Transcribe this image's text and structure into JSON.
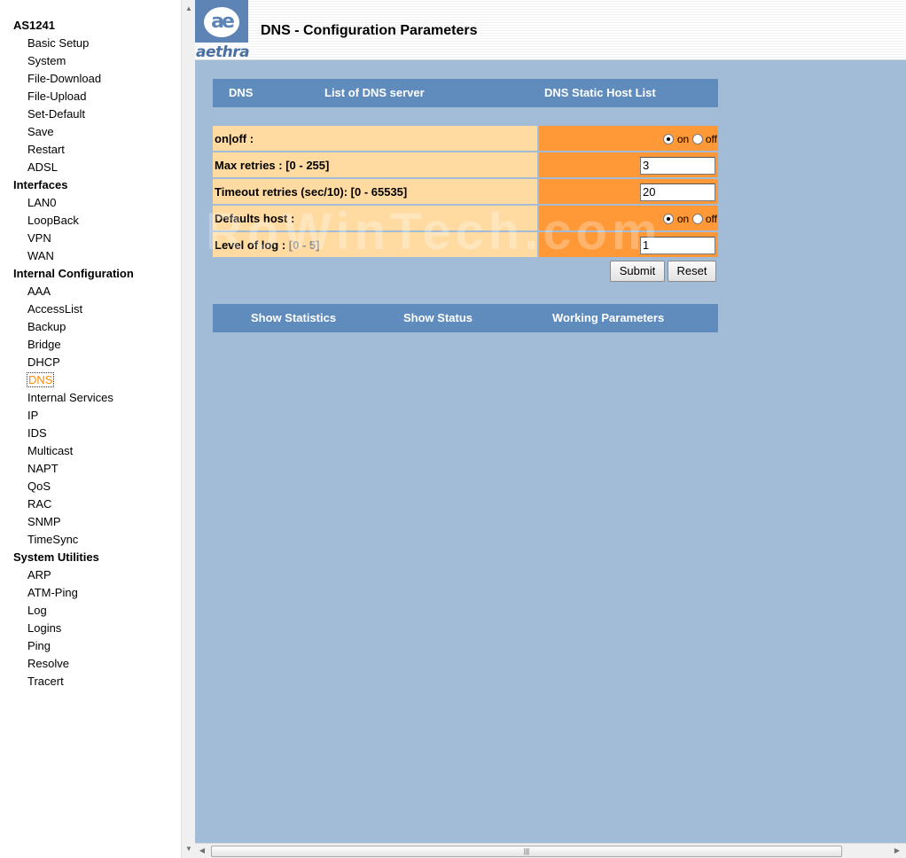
{
  "sidebar": {
    "groups": [
      {
        "title": "AS1241",
        "items": [
          "Basic Setup",
          "System",
          "File-Download",
          "File-Upload",
          "Set-Default",
          "Save",
          "Restart",
          "ADSL"
        ]
      },
      {
        "title": "Interfaces",
        "items": [
          "LAN0",
          "LoopBack",
          "VPN",
          "WAN"
        ]
      },
      {
        "title": "Internal Configuration",
        "items": [
          "AAA",
          "AccessList",
          "Backup",
          "Bridge",
          "DHCP",
          "DNS",
          "Internal Services",
          "IP",
          "IDS",
          "Multicast",
          "NAPT",
          "QoS",
          "RAC",
          "SNMP",
          "TimeSync"
        ]
      },
      {
        "title": "System Utilities",
        "items": [
          "ARP",
          "ATM-Ping",
          "Log",
          "Logins",
          "Ping",
          "Resolve",
          "Tracert"
        ]
      }
    ],
    "active_item": "DNS"
  },
  "header": {
    "logo_text": "aethra",
    "logo_mark": "ae",
    "title": "DNS - Configuration Parameters"
  },
  "top_tabs": [
    "DNS",
    "List of DNS server",
    "DNS Static Host List"
  ],
  "form": {
    "rows": [
      {
        "label": "on|off :",
        "type": "radio",
        "on_label": "on",
        "off_label": "off",
        "selected": "on"
      },
      {
        "label": "Max retries : [0 - 255]",
        "type": "text",
        "value": "3"
      },
      {
        "label": "Timeout retries (sec/10): [0 - 65535]",
        "type": "text",
        "value": "20"
      },
      {
        "label": "Defaults host :",
        "type": "radio",
        "on_label": "on",
        "off_label": "off",
        "selected": "on"
      },
      {
        "label": "Level of log : ",
        "range": "[0 - 5]",
        "type": "text",
        "value": "1"
      }
    ],
    "submit_label": "Submit",
    "reset_label": "Reset"
  },
  "bottom_tabs": [
    "Show Statistics",
    "Show Status",
    "Working Parameters"
  ],
  "watermark": "RoWinTech.com",
  "colors": {
    "page_bg": "#a2bbd7",
    "tab_bg": "#5f8cbc",
    "label_bg": "#ffdba1",
    "value_bg": "#ff9836",
    "active_nav": "#ff8c00"
  }
}
